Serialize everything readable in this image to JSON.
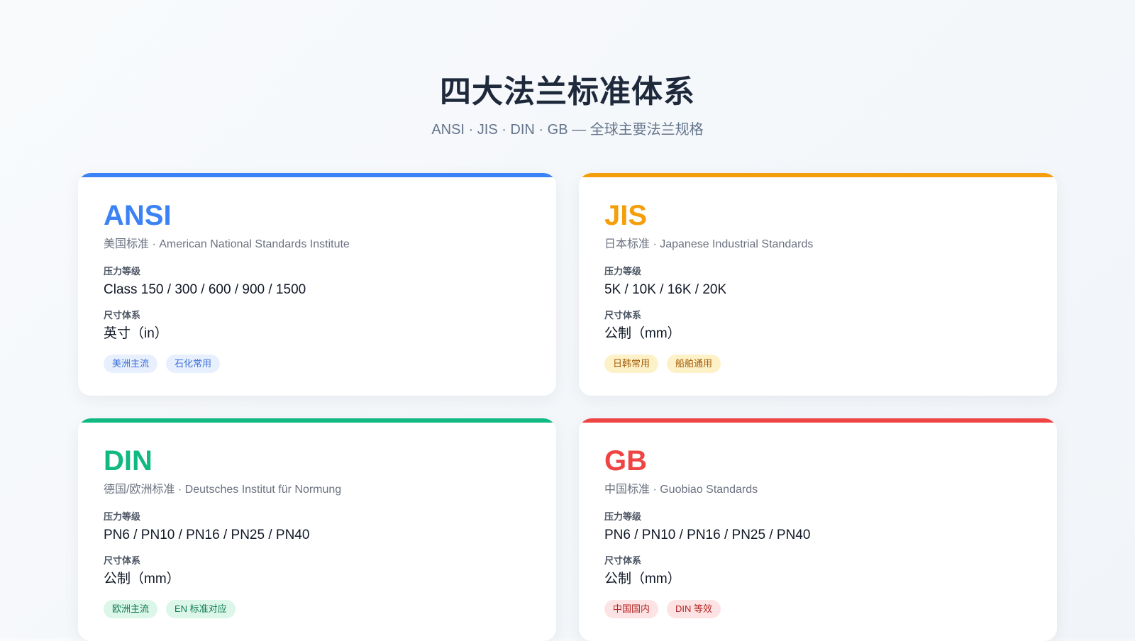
{
  "header": {
    "title": "四大法兰标准体系",
    "subtitle": "ANSI · JIS · DIN · GB — 全球主要法兰规格"
  },
  "labels": {
    "pressure": "压力等级",
    "size": "尺寸体系"
  },
  "cards": [
    {
      "title": "ANSI",
      "subtitle": "美国标准 · American National Standards Institute",
      "pressure": "Class 150 / 300 / 600 / 900 / 1500",
      "size": "英寸（in）",
      "tags": [
        "美洲主流",
        "石化常用"
      ],
      "accent": "#3b82f6"
    },
    {
      "title": "JIS",
      "subtitle": "日本标准 · Japanese Industrial Standards",
      "pressure": "5K / 10K / 16K / 20K",
      "size": "公制（mm）",
      "tags": [
        "日韩常用",
        "船舶通用"
      ],
      "accent": "#f59e0b"
    },
    {
      "title": "DIN",
      "subtitle": "德国/欧洲标准 · Deutsches Institut für Normung",
      "pressure": "PN6 / PN10 / PN16 / PN25 / PN40",
      "size": "公制（mm）",
      "tags": [
        "欧洲主流",
        "EN 标准对应"
      ],
      "accent": "#10b981"
    },
    {
      "title": "GB",
      "subtitle": "中国标准 · Guobiao Standards",
      "pressure": "PN6 / PN10 / PN16 / PN25 / PN40",
      "size": "公制（mm）",
      "tags": [
        "中国国内",
        "DIN 等效"
      ],
      "accent": "#ef4444"
    }
  ]
}
